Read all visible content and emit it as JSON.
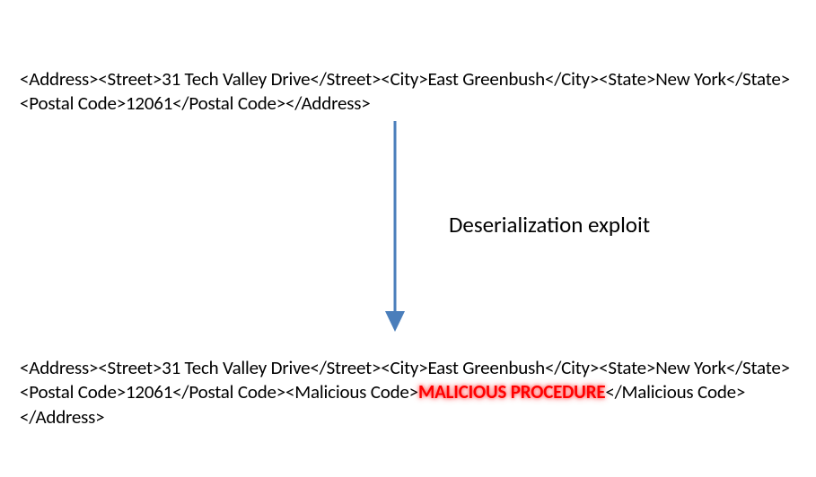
{
  "top_block": {
    "text": "<Address><Street>31 Tech Valley Drive</Street><City>East Greenbush</City><State>New York</State><Postal Code>12061</Postal Code></Address>"
  },
  "arrow": {
    "label": "Deserialization exploit",
    "color": "#4A7EBB"
  },
  "bottom_block": {
    "prefix": "<Address><Street>31 Tech Valley Drive</Street><City>East Greenbush</City><State>New York</State><Postal Code>12061</Postal Code><Malicious Code>",
    "malicious": "MALICIOUS PROCEDURE",
    "suffix": "</Malicious Code></Address>"
  }
}
